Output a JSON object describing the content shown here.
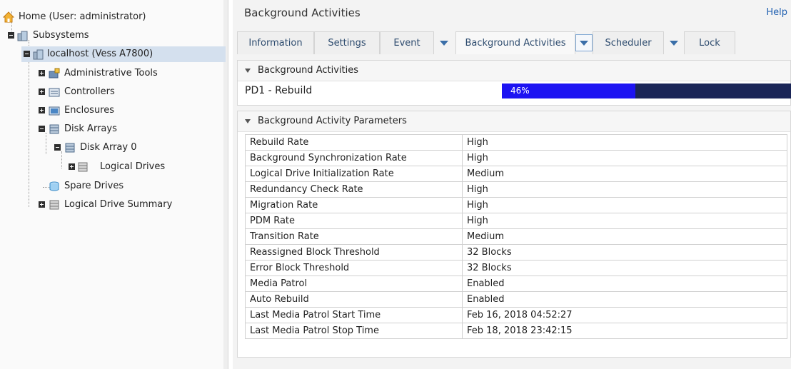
{
  "tree": {
    "home_label": "Home (User: administrator)",
    "subsystems_label": "Subsystems",
    "localhost_label": "localhost (Vess A7800)",
    "admin_tools_label": "Administrative Tools",
    "controllers_label": "Controllers",
    "enclosures_label": "Enclosures",
    "disk_arrays_label": "Disk Arrays",
    "disk_array0_label": "Disk Array 0",
    "logical_drives_label": "Logical Drives",
    "spare_drives_label": "Spare Drives",
    "ld_summary_label": "Logical Drive Summary"
  },
  "header": {
    "title": "Background Activities",
    "help": "Help"
  },
  "tabs": {
    "information": "Information",
    "settings": "Settings",
    "event": "Event",
    "background_activities": "Background Activities",
    "scheduler": "Scheduler",
    "lock": "Lock"
  },
  "activities": {
    "title": "Background Activities",
    "item_name": "PD1 - Rebuild",
    "progress_percent": 46,
    "progress_label": "46%"
  },
  "parameters": {
    "title": "Background Activity Parameters",
    "rows": [
      {
        "key": "Rebuild Rate",
        "value": "High"
      },
      {
        "key": "Background Synchronization Rate",
        "value": "High"
      },
      {
        "key": "Logical Drive Initialization Rate",
        "value": "Medium"
      },
      {
        "key": "Redundancy Check Rate",
        "value": "High"
      },
      {
        "key": "Migration Rate",
        "value": "High"
      },
      {
        "key": "PDM Rate",
        "value": "High"
      },
      {
        "key": "Transition Rate",
        "value": "Medium"
      },
      {
        "key": "Reassigned Block Threshold",
        "value": "32 Blocks"
      },
      {
        "key": "Error Block Threshold",
        "value": "32 Blocks"
      },
      {
        "key": "Media Patrol",
        "value": "Enabled"
      },
      {
        "key": "Auto Rebuild",
        "value": "Enabled"
      },
      {
        "key": "Last Media Patrol Start Time",
        "value": "Feb 16, 2018 04:52:27"
      },
      {
        "key": "Last Media Patrol Stop Time",
        "value": "Feb 18, 2018 23:42:15"
      }
    ]
  },
  "colors": {
    "progress_fill": "#1c13f2",
    "progress_track": "#1a2557",
    "tab_text": "#2d4b6e",
    "selected_node": "#d4e0ee"
  }
}
